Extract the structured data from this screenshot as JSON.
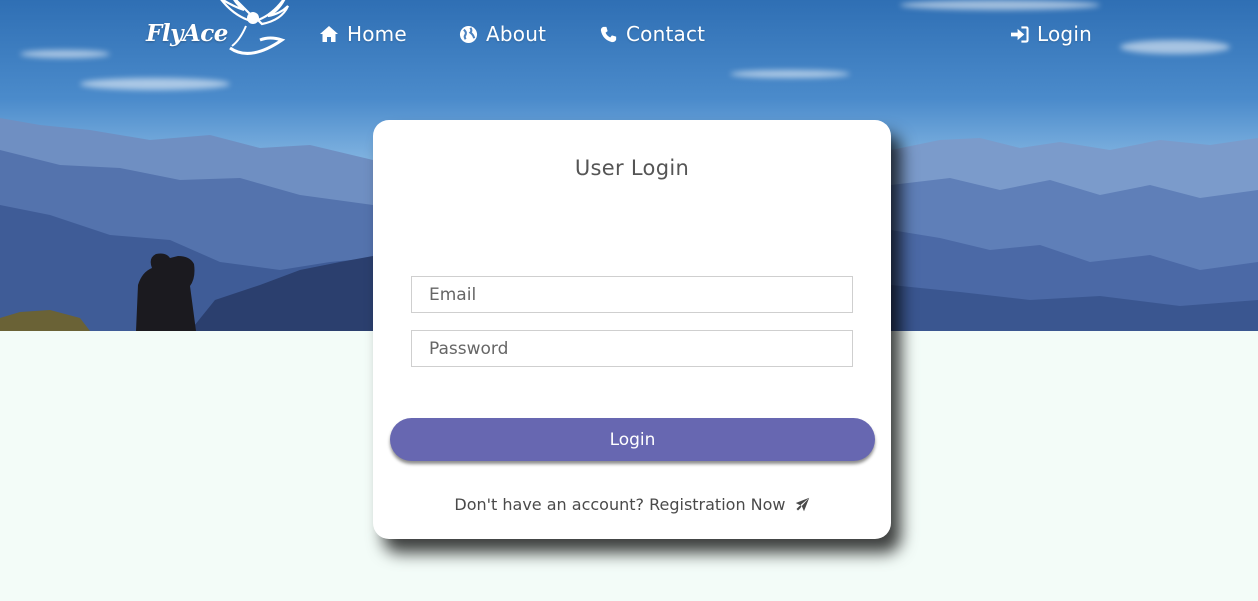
{
  "brand": {
    "logo_text": "FlyAce"
  },
  "nav": {
    "home": "Home",
    "about": "About",
    "contact": "Contact",
    "login": "Login"
  },
  "login_card": {
    "title": "User Login",
    "email_placeholder": "Email",
    "password_placeholder": "Password",
    "submit_label": "Login",
    "register_prompt": "Don't have an account?",
    "register_link": "Registration Now"
  },
  "colors": {
    "accent": "#6767b1",
    "page_background": "#f3fcf8",
    "card_background": "#ffffff"
  },
  "icons": {
    "home": "home-icon",
    "about": "globe-icon",
    "contact": "phone-icon",
    "login": "sign-in-icon",
    "register": "plane-icon"
  }
}
